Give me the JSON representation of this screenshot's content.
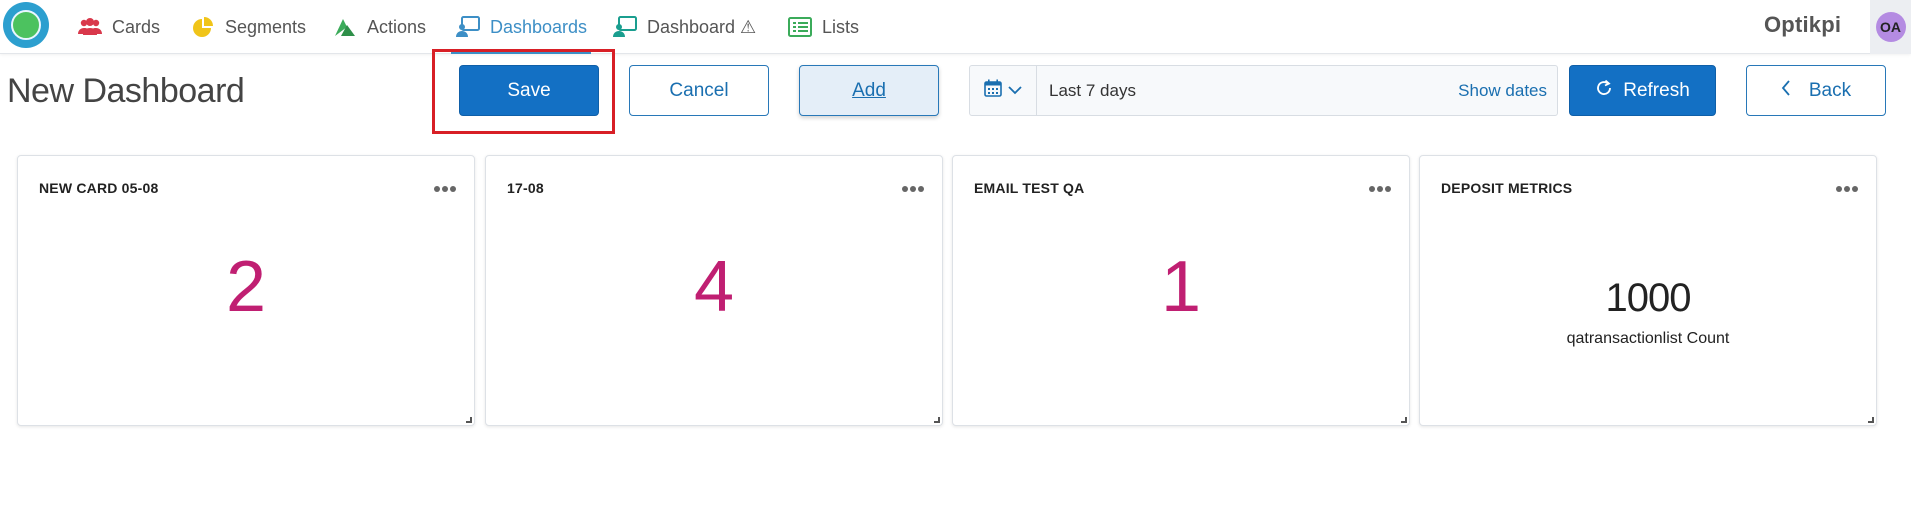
{
  "nav": {
    "items": [
      {
        "label": "Cards",
        "icon": "users-icon",
        "color": "#d9384b"
      },
      {
        "label": "Segments",
        "icon": "pie-chart-icon",
        "color": "#f0c419"
      },
      {
        "label": "Actions",
        "icon": "actions-icon",
        "color": "#3bab5a"
      },
      {
        "label": "Dashboards",
        "icon": "dashboard-icon",
        "color": "#3d8fc6",
        "active": true
      },
      {
        "label": "Dashboard ⚠",
        "icon": "dashboard-icon",
        "color": "#1a9e8f"
      },
      {
        "label": "Lists",
        "icon": "list-icon",
        "color": "#3bab5a"
      }
    ],
    "brand": "Optikpi",
    "avatar_initials": "OA"
  },
  "toolbar": {
    "page_title": "New Dashboard",
    "save_label": "Save",
    "cancel_label": "Cancel",
    "add_label": "Add",
    "date_range": "Last 7 days",
    "show_dates_label": "Show dates",
    "refresh_label": "Refresh",
    "back_label": "Back"
  },
  "cards": [
    {
      "title": "NEW CARD 05-08",
      "value": "2"
    },
    {
      "title": "17-08",
      "value": "4"
    },
    {
      "title": "EMAIL TEST QA",
      "value": "1"
    },
    {
      "title": "DEPOSIT METRICS",
      "value": "1000",
      "subtitle": "qatransactionlist Count"
    }
  ],
  "colors": {
    "primary": "#1370c4",
    "accent_value": "#c01f72",
    "highlight": "#d81f26"
  }
}
